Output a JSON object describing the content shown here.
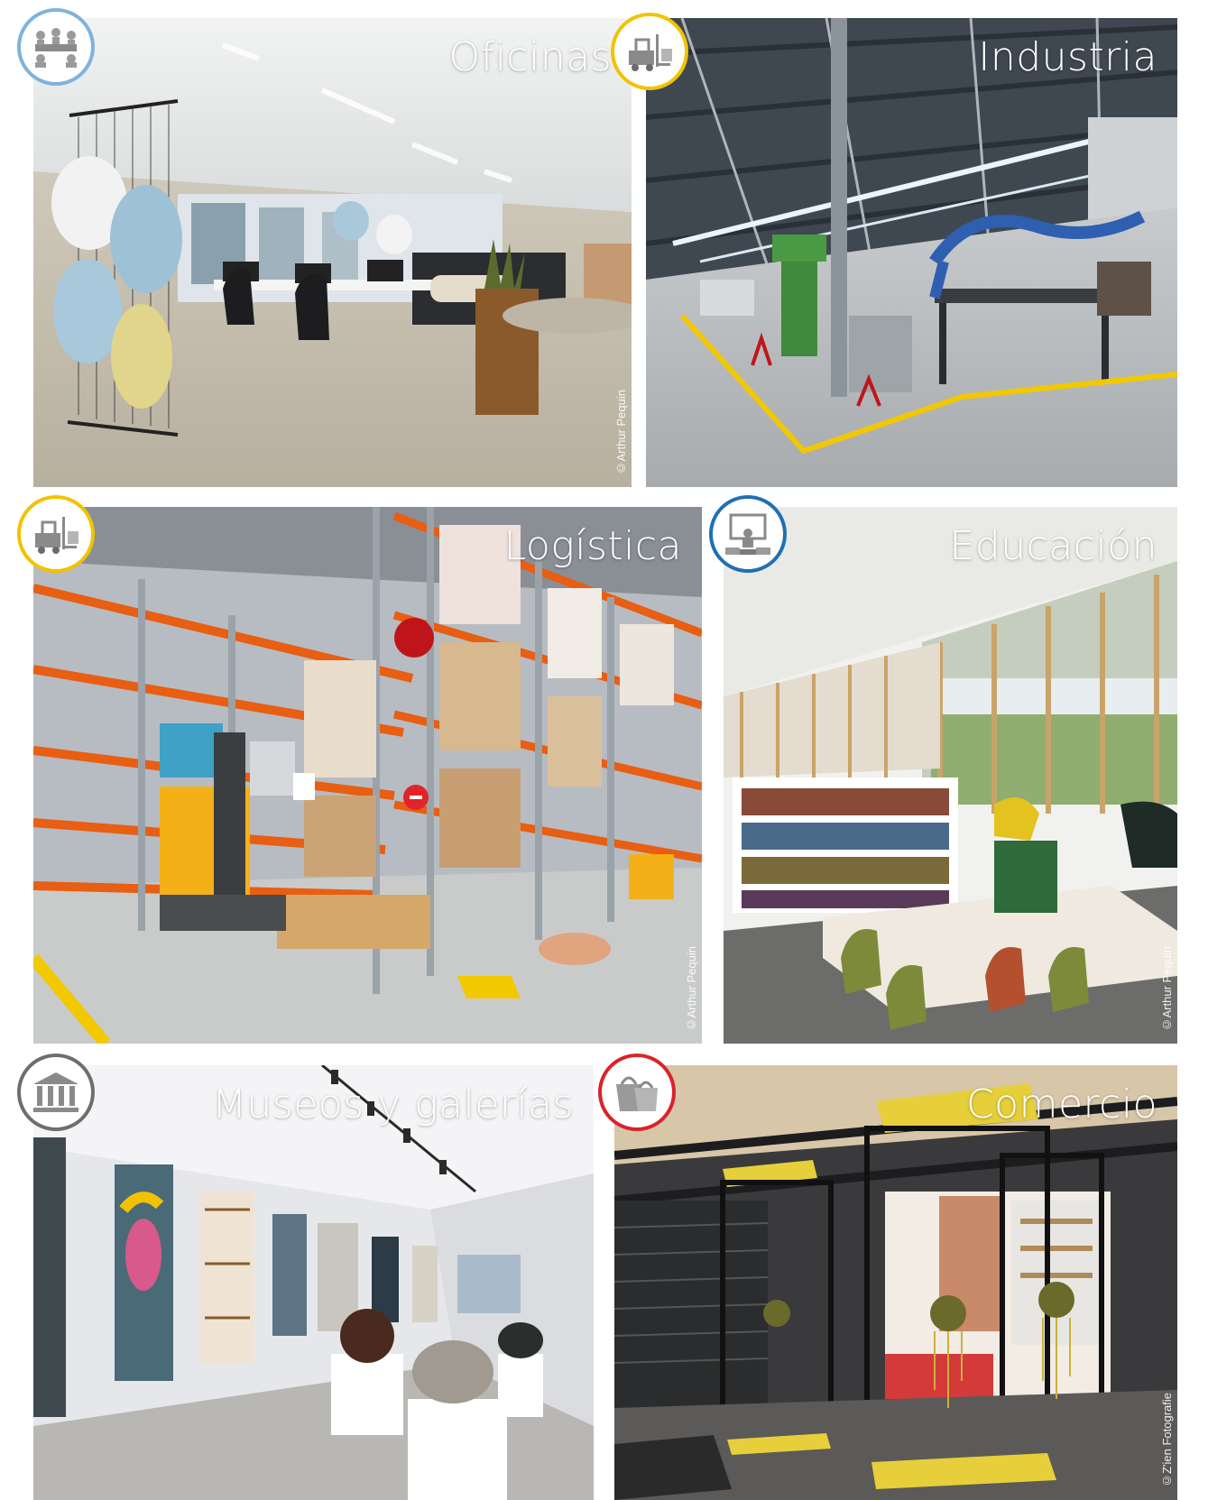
{
  "tiles": [
    {
      "title": "Oficinas",
      "credit": "©Arthur Pequin"
    },
    {
      "title": "Industria",
      "credit": ""
    },
    {
      "title": "Logística",
      "credit": "©Arthur Pequin"
    },
    {
      "title": "Educación",
      "credit": "©Arthur Pequin"
    },
    {
      "title": "Museos y galerías",
      "credit": ""
    },
    {
      "title": "Comercio",
      "credit": "©Z'ien Fotografie"
    }
  ],
  "badges": [
    {
      "icon": "meeting-icon",
      "color": "#7fb3dc"
    },
    {
      "icon": "forklift-icon",
      "color": "#f2c200"
    },
    {
      "icon": "forklift-icon",
      "color": "#f2c200"
    },
    {
      "icon": "classroom-icon",
      "color": "#1f6fb5"
    },
    {
      "icon": "museum-icon",
      "color": "#6e6e6e"
    },
    {
      "icon": "shopping-bag-icon",
      "color": "#d9232a"
    }
  ]
}
